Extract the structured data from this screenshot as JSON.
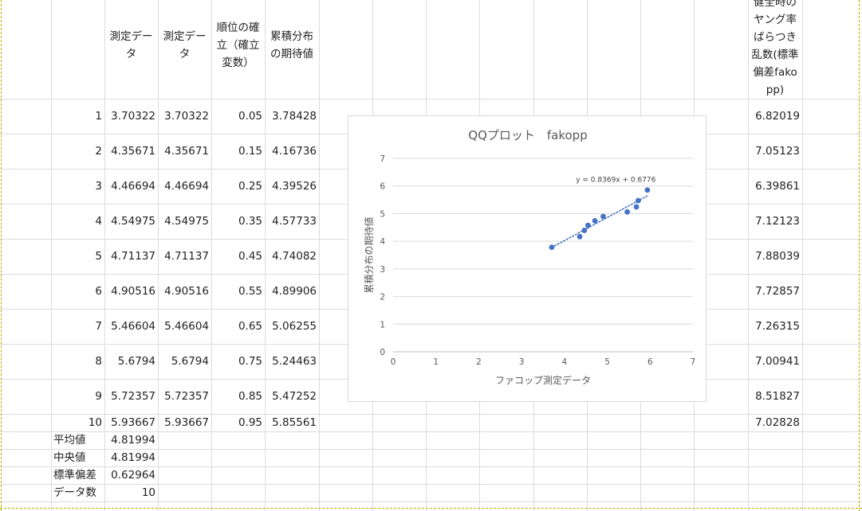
{
  "headers": {
    "colC": "測定データ",
    "colD": "測定データ",
    "colE": "順位の確立（確立変数）",
    "colF": "累積分布の期待値",
    "colR": "健全時のヤング率ばらつき乱数(標準偏差fakopp)"
  },
  "rows": [
    {
      "n": "1",
      "c": "3.70322",
      "d": "3.70322",
      "e": "0.05",
      "f": "3.78428",
      "r": "6.82019"
    },
    {
      "n": "2",
      "c": "4.35671",
      "d": "4.35671",
      "e": "0.15",
      "f": "4.16736",
      "r": "7.05123"
    },
    {
      "n": "3",
      "c": "4.46694",
      "d": "4.46694",
      "e": "0.25",
      "f": "4.39526",
      "r": "6.39861"
    },
    {
      "n": "4",
      "c": "4.54975",
      "d": "4.54975",
      "e": "0.35",
      "f": "4.57733",
      "r": "7.12123"
    },
    {
      "n": "5",
      "c": "4.71137",
      "d": "4.71137",
      "e": "0.45",
      "f": "4.74082",
      "r": "7.88039"
    },
    {
      "n": "6",
      "c": "4.90516",
      "d": "4.90516",
      "e": "0.55",
      "f": "4.89906",
      "r": "7.72857"
    },
    {
      "n": "7",
      "c": "5.46604",
      "d": "5.46604",
      "e": "0.65",
      "f": "5.06255",
      "r": "7.26315"
    },
    {
      "n": "8",
      "c": "5.6794",
      "d": "5.6794",
      "e": "0.75",
      "f": "5.24463",
      "r": "7.00941"
    },
    {
      "n": "9",
      "c": "5.72357",
      "d": "5.72357",
      "e": "0.85",
      "f": "5.47252",
      "r": "8.51827"
    },
    {
      "n": "10",
      "c": "5.93667",
      "d": "5.93667",
      "e": "0.95",
      "f": "5.85561",
      "r": "7.02828"
    }
  ],
  "stats": [
    {
      "label": "平均値",
      "value": "4.81994"
    },
    {
      "label": "中央値",
      "value": "4.81994"
    },
    {
      "label": "標準偏差",
      "value": "0.62964"
    },
    {
      "label": "データ数",
      "value": "10"
    }
  ],
  "chart_data": {
    "type": "scatter",
    "title": "QQプロット　fakopp",
    "xlabel": "ファコップ測定データ",
    "ylabel": "累積分布の期待値",
    "xlim": [
      0,
      7
    ],
    "ylim": [
      0,
      7
    ],
    "xticks": [
      0,
      1,
      2,
      3,
      4,
      5,
      6,
      7
    ],
    "yticks": [
      0,
      1,
      2,
      3,
      4,
      5,
      6,
      7
    ],
    "grid": true,
    "legend": "none",
    "point_color": "#4472c4",
    "trendline": {
      "type": "linear",
      "equation": "y = 0.8369x + 0.6776",
      "slope": 0.8369,
      "intercept": 0.6776,
      "style": "dotted"
    },
    "series": [
      {
        "x": [
          3.70322,
          4.35671,
          4.46694,
          4.54975,
          4.71137,
          4.90516,
          5.46604,
          5.6794,
          5.72357,
          5.93667
        ],
        "y": [
          3.78428,
          4.16736,
          4.39526,
          4.57733,
          4.74082,
          4.89906,
          5.06255,
          5.24463,
          5.47252,
          5.85561
        ]
      }
    ]
  }
}
